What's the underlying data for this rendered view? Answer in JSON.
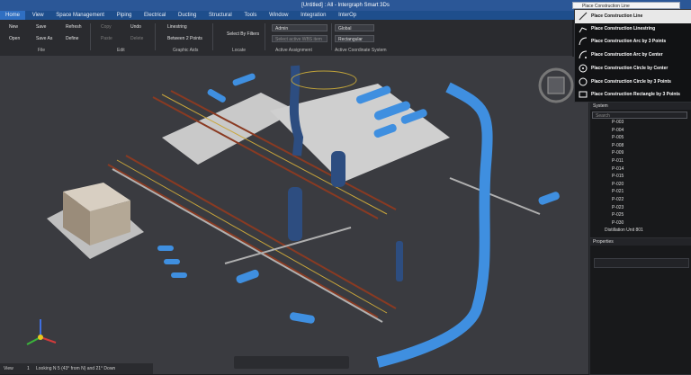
{
  "titlebar": {
    "title": "[Untitled] : All - Intergraph Smart 3Ds"
  },
  "menu": [
    "Home",
    "View",
    "Space Management",
    "Piping",
    "Electrical",
    "Ducting",
    "Structural",
    "Tools",
    "Window",
    "Integration",
    "InterOp"
  ],
  "ribbon": {
    "file": {
      "new": "New",
      "open": "Open",
      "save": "Save",
      "save_as": "Save As",
      "refresh": "Refresh",
      "define": "Define",
      "group": "File"
    },
    "edit": {
      "copy": "Copy",
      "paste": "Paste",
      "undo": "Undo",
      "delete": "Delete",
      "group": "Edit"
    },
    "graphic_aids": {
      "linestring": "Linestring",
      "between_points": "Between 2 Points",
      "group": "Graphic Aids"
    },
    "locate": {
      "select_by_filters": "Select By Filters",
      "group": "Locate"
    },
    "active_assignment": {
      "permission": "Admin",
      "wbs_placeholder": "Select active WBS item",
      "group": "Active Assignment"
    },
    "coordinate_system": {
      "system": "Global",
      "type": "Rectangular",
      "group": "Active Coordinate System"
    }
  },
  "search": {
    "value": "Place Construction Line"
  },
  "dropdown": [
    "Place Construction Line",
    "Place Construction Linestring",
    "Place Construction Arc by 3 Points",
    "Place Construction Arc by Center",
    "Place Construction Circle by Center",
    "Place Construction Circle by 3 Points",
    "Place Construction Rectangle by 3 Points"
  ],
  "system_panel": {
    "title": "System",
    "search_placeholder": "Search",
    "items": [
      "P-003",
      "P-004",
      "P-005",
      "P-008",
      "P-009",
      "P-011",
      "P-014",
      "P-015",
      "P-020",
      "P-021",
      "P-022",
      "P-023",
      "P-025",
      "P-030",
      "Distillation Unit 801"
    ]
  },
  "properties_panel": {
    "title": "Properties"
  },
  "status": {
    "view": "View",
    "count": "1",
    "text": "Looking N 5 (43° from N) and 21° Down"
  },
  "colors": {
    "titlebar": "#2b5797",
    "pipe": "#3f8fe0",
    "steel": "#8a3a22"
  }
}
